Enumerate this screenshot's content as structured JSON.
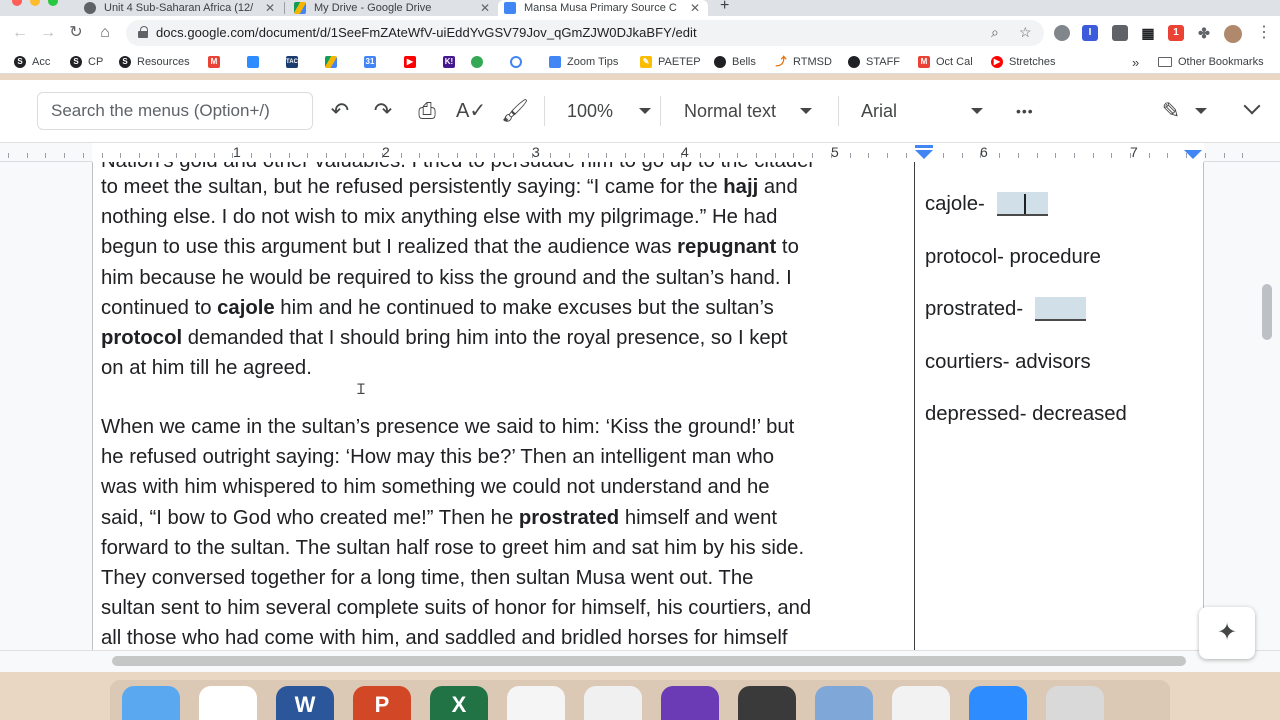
{
  "browser": {
    "tabs": [
      {
        "title": "Unit 4 Sub-Saharan Africa (12/",
        "active": false
      },
      {
        "title": "My Drive - Google Drive",
        "active": false
      },
      {
        "title": "Mansa Musa Primary Source C",
        "active": true
      }
    ],
    "url": "docs.google.com/document/d/1SeeFmZAteWfV-uiEddYvGSV79Jov_qGmZJW0DJkaBFY/edit",
    "bookmarks": [
      "Acc",
      "CP",
      "Resources",
      "Zoom Tips",
      "PAETEP",
      "Bells",
      "RTMSD",
      "STAFF",
      "Oct Cal",
      "Stretches"
    ],
    "other_bookmarks": "Other Bookmarks",
    "more_bookmarks": "»",
    "extension_badge": "1"
  },
  "docs_toolbar": {
    "search_placeholder": "Search the menus (Option+/)",
    "zoom": "100%",
    "style": "Normal text",
    "font": "Arial",
    "more": "•••"
  },
  "ruler": {
    "numbers": [
      "1",
      "2",
      "3",
      "4",
      "5",
      "6",
      "7"
    ]
  },
  "document": {
    "cut_off_line": "Nation's gold and other valuables. I tried to persuade him to go up to the citadel",
    "paragraph1": [
      [
        {
          "t": "to meet the sultan, but he refused persistently saying: “I came for the "
        },
        {
          "t": "hajj",
          "b": true
        },
        {
          "t": " and"
        }
      ],
      [
        {
          "t": "nothing else.  I do not wish to mix anything else with my pilgrimage.”  He had"
        }
      ],
      [
        {
          "t": "begun to use this argument but I realized that the audience was "
        },
        {
          "t": "repugnant",
          "b": true
        },
        {
          "t": " to"
        }
      ],
      [
        {
          "t": "him because he would be required to kiss the ground and the sultan’s hand.  I"
        }
      ],
      [
        {
          "t": "continued to "
        },
        {
          "t": "cajole",
          "b": true
        },
        {
          "t": " him and he continued to make excuses but the sultan’s"
        }
      ],
      [
        {
          "t": "protocol",
          "b": true
        },
        {
          "t": " demanded that I should bring him into the royal presence, so I kept"
        }
      ],
      [
        {
          "t": "on at him till he agreed."
        }
      ]
    ],
    "paragraph2": [
      [
        {
          "t": "When we came in the sultan’s presence we said to him: ‘Kiss the ground!’ but"
        }
      ],
      [
        {
          "t": "he refused outright saying: ‘How may this be?’  Then an intelligent man who"
        }
      ],
      [
        {
          "t": "was with him whispered to him something we could not understand and he"
        }
      ],
      [
        {
          "t": "said, “I bow to God who created me!” Then he "
        },
        {
          "t": "prostrated",
          "b": true
        },
        {
          "t": " himself and went"
        }
      ],
      [
        {
          "t": "forward to the sultan.  The sultan half rose to greet him and sat him by his side."
        }
      ],
      [
        {
          "t": "They conversed together for a long time, then sultan Musa went out.  The"
        }
      ],
      [
        {
          "t": "sultan sent to him several complete suits of honor for himself, his courtiers, and"
        }
      ],
      [
        {
          "t": "all those who had come with him, and saddled and bridled horses for himself"
        }
      ]
    ],
    "vocab": [
      {
        "term": "cajole-",
        "definition": "",
        "blank": true
      },
      {
        "term": "protocol- procedure",
        "definition": "",
        "blank": false
      },
      {
        "term": "prostrated-",
        "definition": "",
        "blank": true
      },
      {
        "term": "courtiers- advisors",
        "definition": "",
        "blank": false
      },
      {
        "term": "depressed- decreased",
        "definition": "",
        "blank": false
      }
    ]
  },
  "dock": {
    "apps": [
      {
        "icon": "finder-icon",
        "label": ""
      },
      {
        "icon": "chrome-icon",
        "label": ""
      },
      {
        "icon": "word-icon",
        "label": "W"
      },
      {
        "icon": "powerpoint-icon",
        "label": "P"
      },
      {
        "icon": "excel-icon",
        "label": "X"
      },
      {
        "icon": "photos-icon",
        "label": ""
      },
      {
        "icon": "news-icon",
        "label": ""
      },
      {
        "icon": "imovie-icon",
        "label": ""
      },
      {
        "icon": "quicktime-icon",
        "label": ""
      },
      {
        "icon": "mail-icon",
        "label": ""
      },
      {
        "icon": "numbers-icon",
        "label": ""
      },
      {
        "icon": "zoom-icon",
        "label": ""
      },
      {
        "icon": "trash-icon",
        "label": ""
      }
    ]
  },
  "colors": {
    "accent_blue": "#4285f4",
    "blank_fill": "#d0dfe8",
    "desktop": "#e9d7c4"
  }
}
